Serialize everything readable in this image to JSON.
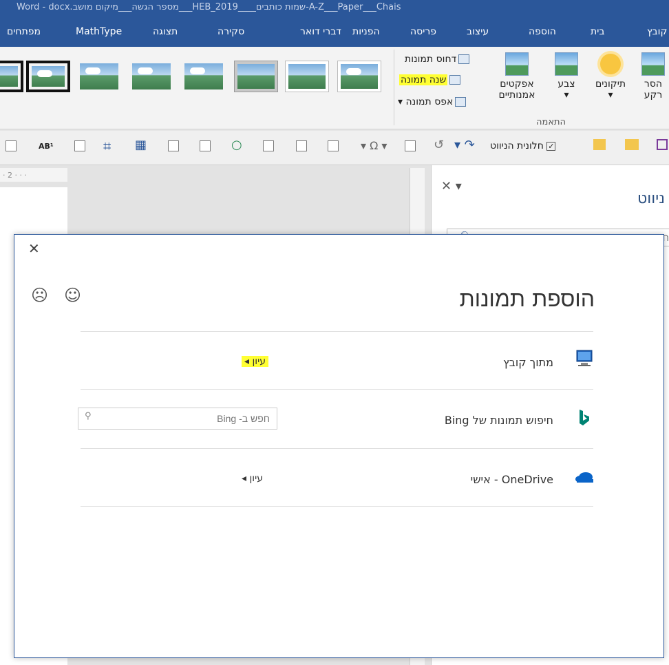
{
  "titlebar": {
    "text": "Word - docx.מספר הגשה___מיקום מושב___HEB_2019____שמות כותבים-A-Z___Paper___Chais"
  },
  "tabs": [
    {
      "label": "קובץ"
    },
    {
      "label": "בית"
    },
    {
      "label": "הוספה"
    },
    {
      "label": "עיצוב"
    },
    {
      "label": "פריסה"
    },
    {
      "label": "הפניות"
    },
    {
      "label": "דברי דואר"
    },
    {
      "label": "סקירה"
    },
    {
      "label": "תצוגה"
    },
    {
      "label": "MathType"
    },
    {
      "label": "מפתחים"
    }
  ],
  "ribbon": {
    "compress_label": "דחוס תמונות",
    "change_picture_label": "שנה תמונה",
    "reset_picture_label": "אפס תמונה",
    "effects_label": "אפקטים",
    "artistic_label": "אמנותיים",
    "color_label": "צבע",
    "corrections_label": "תיקונים",
    "remove_bg_label": "הסר רקע",
    "group_label": "התאמה"
  },
  "qat": {
    "nav_pane_label": "חלונית הניווט"
  },
  "ruler": {
    "text": "· 2 · · ·"
  },
  "navpane": {
    "title": "ניווט",
    "search_placeholder": "חפש במסמך"
  },
  "dialog": {
    "title": "הוספת תמונות",
    "rows": [
      {
        "label": "מתוך קובץ",
        "action": "עיון"
      },
      {
        "label": "חיפוש תמונות של Bing",
        "search_placeholder": "חפש ב- Bing"
      },
      {
        "label": "OneDrive - אישי",
        "action": "עיון"
      }
    ]
  },
  "colors": {
    "accent": "#2b579a",
    "highlight": "#ffff33",
    "bing": "#008373",
    "onedrive": "#0a64c8"
  }
}
